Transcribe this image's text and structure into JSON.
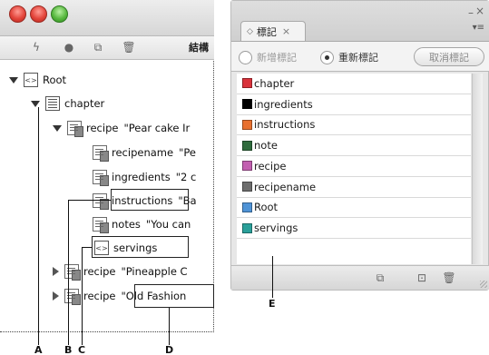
{
  "structure_panel": {
    "heading": "結構",
    "toolbar_icons": [
      "lightning-icon",
      "circle-icon",
      "new-element-icon",
      "trash-icon"
    ],
    "tree": [
      {
        "id": "root",
        "label": "Root",
        "value": "",
        "expanded": true,
        "icon": "xml-icon"
      },
      {
        "id": "chapter",
        "label": "chapter",
        "value": "",
        "expanded": true,
        "icon": "chapter-icon"
      },
      {
        "id": "recipe1",
        "label": "recipe",
        "value": "\"Pear cake Ir",
        "expanded": true,
        "icon": "element-icon"
      },
      {
        "id": "recipename",
        "label": "recipename",
        "value": "\"Pe",
        "icon": "element-icon"
      },
      {
        "id": "ingredients",
        "label": "ingredients",
        "value": "\"2 c",
        "icon": "element-icon"
      },
      {
        "id": "instructions",
        "label": "instructions",
        "value": "\"Ba",
        "icon": "element-icon"
      },
      {
        "id": "notes",
        "label": "notes",
        "value": "\"You can",
        "icon": "element-icon"
      },
      {
        "id": "servings",
        "label": "servings",
        "value": "",
        "icon": "xml-icon"
      },
      {
        "id": "recipe2",
        "label": "recipe",
        "value": "\"Pineapple C",
        "expanded": false,
        "icon": "element-icon"
      },
      {
        "id": "recipe3",
        "label": "recipe",
        "value": "\"Old Fashion",
        "expanded": false,
        "icon": "element-icon"
      }
    ]
  },
  "tags_panel": {
    "tab_label": "標記",
    "tab_close": "×",
    "option_add": "新增標記",
    "option_retag": "重新標記",
    "untag_button": "取消標記",
    "tags": [
      {
        "name": "chapter",
        "color": "#d9323b"
      },
      {
        "name": "ingredients",
        "color": "#000000"
      },
      {
        "name": "instructions",
        "color": "#e8702f"
      },
      {
        "name": "note",
        "color": "#2f6b3d"
      },
      {
        "name": "recipe",
        "color": "#c25fb0"
      },
      {
        "name": "recipename",
        "color": "#6d6d6d"
      },
      {
        "name": "Root",
        "color": "#4f93d6"
      },
      {
        "name": "servings",
        "color": "#2aa09a"
      }
    ],
    "bottom_icons": [
      "map-styles-icon",
      "new-tag-icon",
      "trash-icon"
    ]
  },
  "callouts": {
    "A": "A",
    "B": "B",
    "C": "C",
    "D": "D",
    "E": "E"
  }
}
